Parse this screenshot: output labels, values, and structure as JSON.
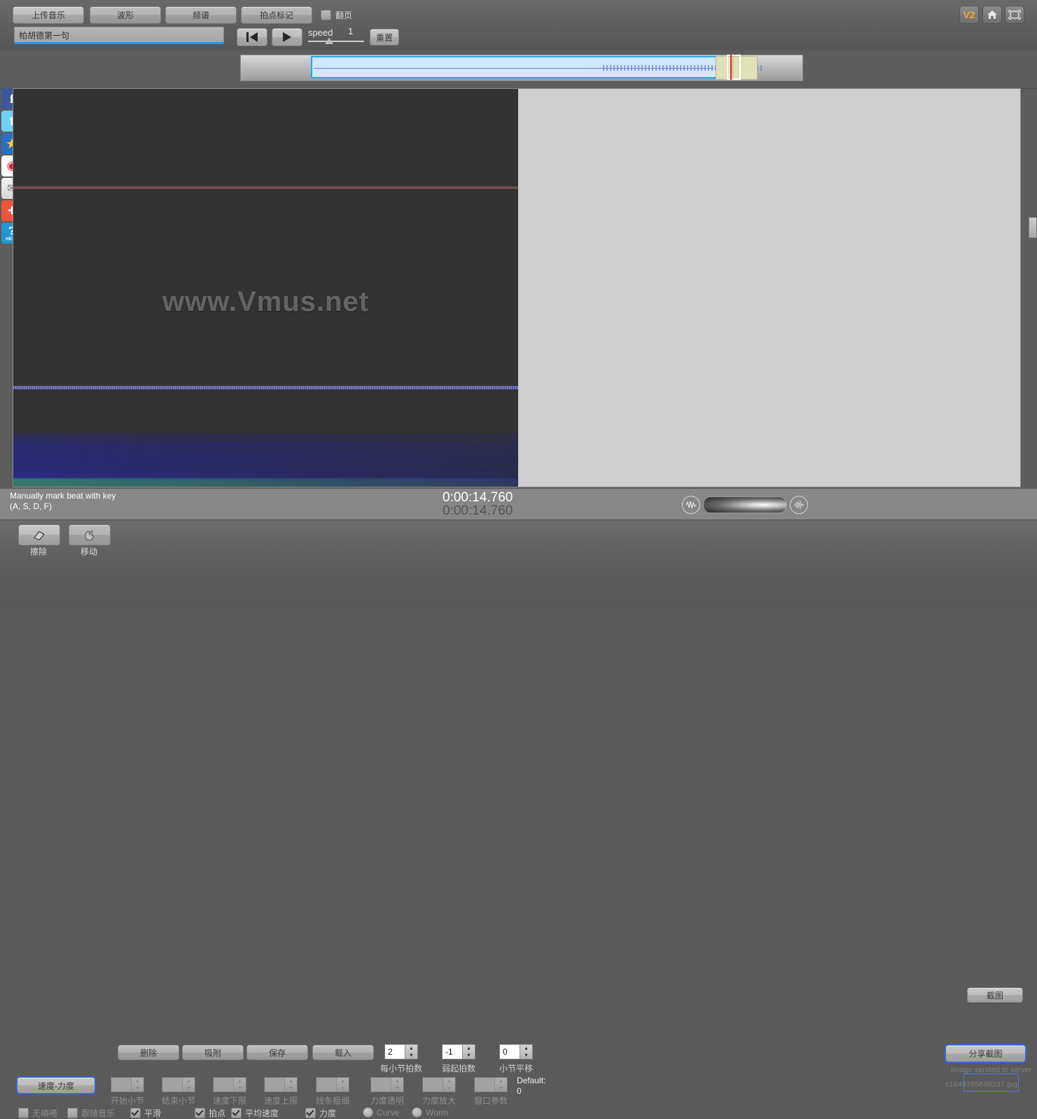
{
  "toolbar": {
    "upload_music": "上传音乐",
    "waveform": "波形",
    "spectrum": "频谱",
    "beat_mark": "拍点标记",
    "page_turn_label": "翻页",
    "page_turn_checked": false,
    "track_name": "帕胡德第一句",
    "speed_label": "speed",
    "speed_value": "1",
    "reset": "重置",
    "version_badge": "V2",
    "home_icon": "home-icon",
    "fullscreen_icon": "fullscreen-icon",
    "prev_icon": "skip-back-icon",
    "play_icon": "play-icon"
  },
  "social": [
    {
      "name": "facebook",
      "glyph": "f"
    },
    {
      "name": "twitter",
      "glyph": "t"
    },
    {
      "name": "qzone",
      "glyph": "★"
    },
    {
      "name": "weibo",
      "glyph": "◉"
    },
    {
      "name": "email",
      "glyph": "✉"
    },
    {
      "name": "share-more",
      "glyph": "+"
    },
    {
      "name": "help",
      "glyph": "?",
      "sub": "HELP"
    }
  ],
  "viewer": {
    "watermark": "www.Vmus.net"
  },
  "status": {
    "hint_line1": "Manually mark beat with key",
    "hint_line2": "(A, S, D, F)",
    "time_current": "0:00:14.760",
    "time_total": "0:00:14.760",
    "screenshot_button": "截图",
    "volume_left_icon": "waveform-icon",
    "volume_right_icon": "audio-wave-icon"
  },
  "tools": {
    "erase_label": "擦除",
    "erase_icon": "eraser-icon",
    "move_label": "移动",
    "move_icon": "hand-move-icon",
    "delete": "删除",
    "snap": "吸附",
    "save": "保存",
    "load": "载入",
    "speed_dynamics": "速度-力度",
    "default_label": "Default:",
    "default_value": "0"
  },
  "spinners_row1": [
    {
      "value": "2",
      "caption": "每小节拍数",
      "enabled": true
    },
    {
      "value": "-1",
      "caption": "弱起拍数",
      "enabled": true
    },
    {
      "value": "0",
      "caption": "小节平移",
      "enabled": true
    }
  ],
  "spinners_row2": [
    {
      "value": "",
      "caption": "开始小节",
      "enabled": false
    },
    {
      "value": "",
      "caption": "结束小节",
      "enabled": false
    },
    {
      "value": "",
      "caption": "速度下限",
      "enabled": false
    },
    {
      "value": "",
      "caption": "速度上限",
      "enabled": false
    },
    {
      "value": "",
      "caption": "线条粗细",
      "enabled": false
    },
    {
      "value": "",
      "caption": "力度透明",
      "enabled": false
    },
    {
      "value": "",
      "caption": "力度放大",
      "enabled": false
    },
    {
      "value": "",
      "caption": "窗口参数",
      "enabled": false
    }
  ],
  "checkboxes": [
    {
      "label": "无嘀嗒",
      "checked": false,
      "dim": true
    },
    {
      "label": "跟随音乐",
      "checked": false,
      "dim": true
    },
    {
      "label": "平滑",
      "checked": true,
      "dim": false
    },
    {
      "label": "拍点",
      "checked": true,
      "dim": false
    },
    {
      "label": "平均速度",
      "checked": true,
      "dim": false
    },
    {
      "label": "力度",
      "checked": true,
      "dim": false
    }
  ],
  "radios": [
    {
      "label": "Curve",
      "selected": false
    },
    {
      "label": "Worm",
      "selected": false
    }
  ],
  "share": {
    "button": "分享截图",
    "sent_message": "Image sended to server",
    "sent_file": "s1649765698237.jpg"
  },
  "colors": {
    "accent_blue": "#2196f3",
    "focus_blue": "#3d63d8",
    "badge_orange": "#f5a623",
    "playhead_red": "#e02020",
    "timeline_select": "#cfe8fb",
    "panel_gray": "#5d5d5d"
  }
}
